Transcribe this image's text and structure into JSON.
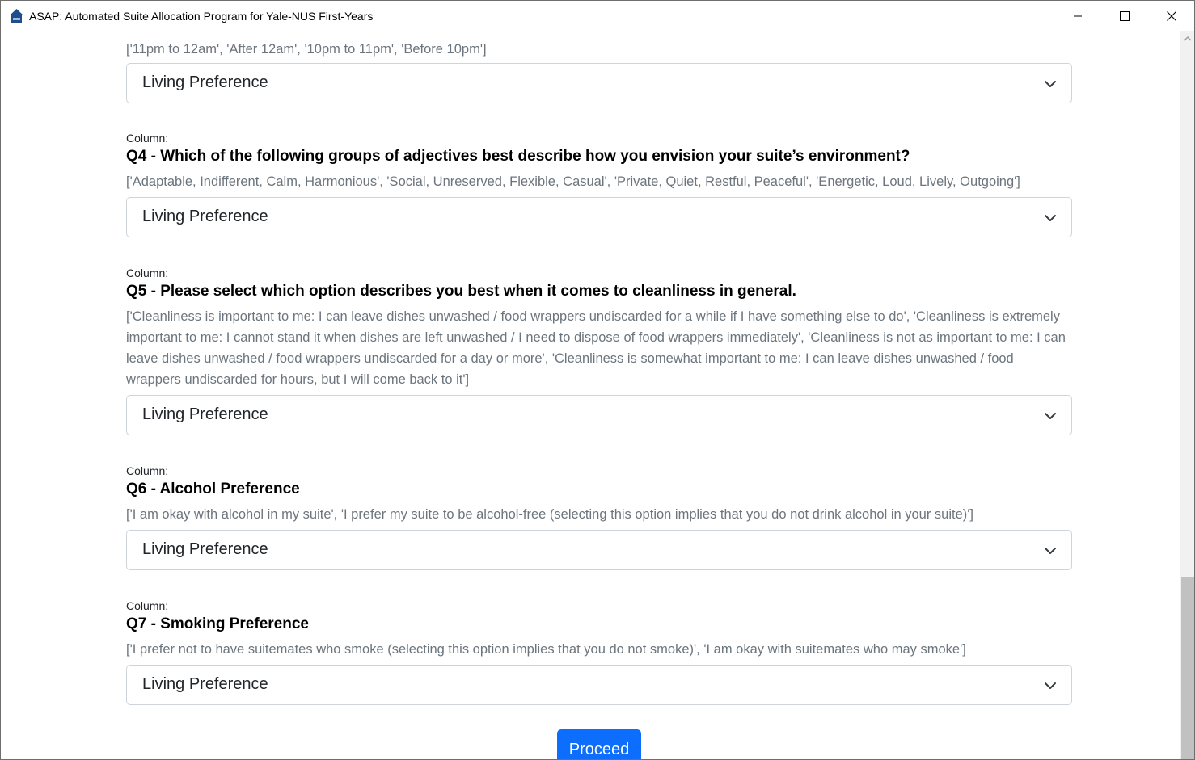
{
  "window": {
    "title": "ASAP: Automated Suite Allocation Program for Yale-NUS First-Years",
    "icon": "house-icon"
  },
  "partial_top": {
    "options": "['11pm to 12am', 'After 12am', '10pm to 11pm', 'Before 10pm']",
    "select_value": "Living Preference"
  },
  "questions": [
    {
      "column_label": "Column:",
      "title": "Q4 - Which of the following groups of adjectives best describe how you envision your suite’s environment?",
      "options": "['Adaptable, Indifferent, Calm, Harmonious', 'Social, Unreserved, Flexible, Casual', 'Private, Quiet, Restful, Peaceful', 'Energetic, Loud, Lively, Outgoing']",
      "select_value": "Living Preference"
    },
    {
      "column_label": "Column:",
      "title": "Q5 - Please select which option describes you best when it comes to cleanliness in general.",
      "options": "['Cleanliness is important to me: I can leave dishes unwashed / food wrappers undiscarded for a while if I have something else to do', 'Cleanliness is extremely important to me: I cannot stand it when dishes are left unwashed / I need to dispose of food wrappers immediately', 'Cleanliness is not as important to me: I can leave dishes unwashed / food wrappers undiscarded for a day or more', 'Cleanliness is somewhat important to me: I can leave dishes unwashed / food wrappers undiscarded for hours, but I will come back to it']",
      "select_value": "Living Preference"
    },
    {
      "column_label": "Column:",
      "title": "Q6 - Alcohol Preference",
      "options": "['I am okay with alcohol in my suite', 'I prefer my suite to be alcohol-free (selecting this option implies that you do not drink alcohol in your suite)']",
      "select_value": "Living Preference"
    },
    {
      "column_label": "Column:",
      "title": "Q7 - Smoking Preference",
      "options": "['I prefer not to have suitemates who smoke (selecting this option implies that you do not smoke)', 'I am okay with suitemates who may smoke']",
      "select_value": "Living Preference"
    }
  ],
  "proceed_label": "Proceed",
  "colors": {
    "primary": "#0d6efd",
    "muted_text": "#6c757d",
    "border": "#ced4da"
  }
}
